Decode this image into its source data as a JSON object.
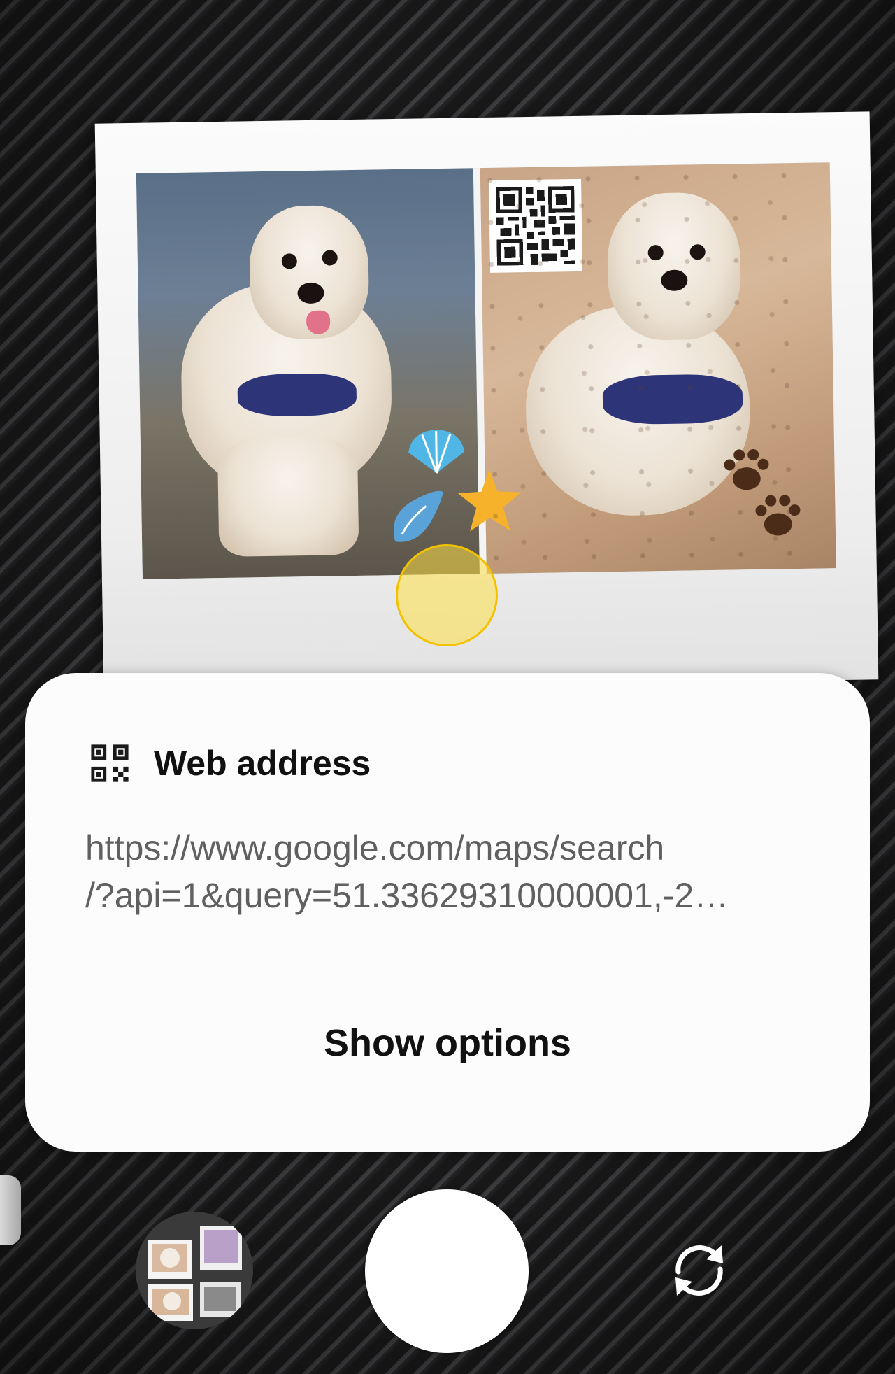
{
  "result_card": {
    "title": "Web address",
    "icon": "qr-code-icon",
    "url_line1": "https://www.google.com/maps/search",
    "url_line2": "/?api=1&query=51.33629310000001,-2…",
    "action_label": "Show options"
  },
  "camera_controls": {
    "gallery_icon": "gallery-thumbnail",
    "shutter_icon": "shutter-button",
    "switch_icon": "switch-camera-icon"
  },
  "colors": {
    "card_background": "#fcfcfc",
    "focus_ring": "#f2c200",
    "title_text": "#111111",
    "url_text": "#606060"
  }
}
